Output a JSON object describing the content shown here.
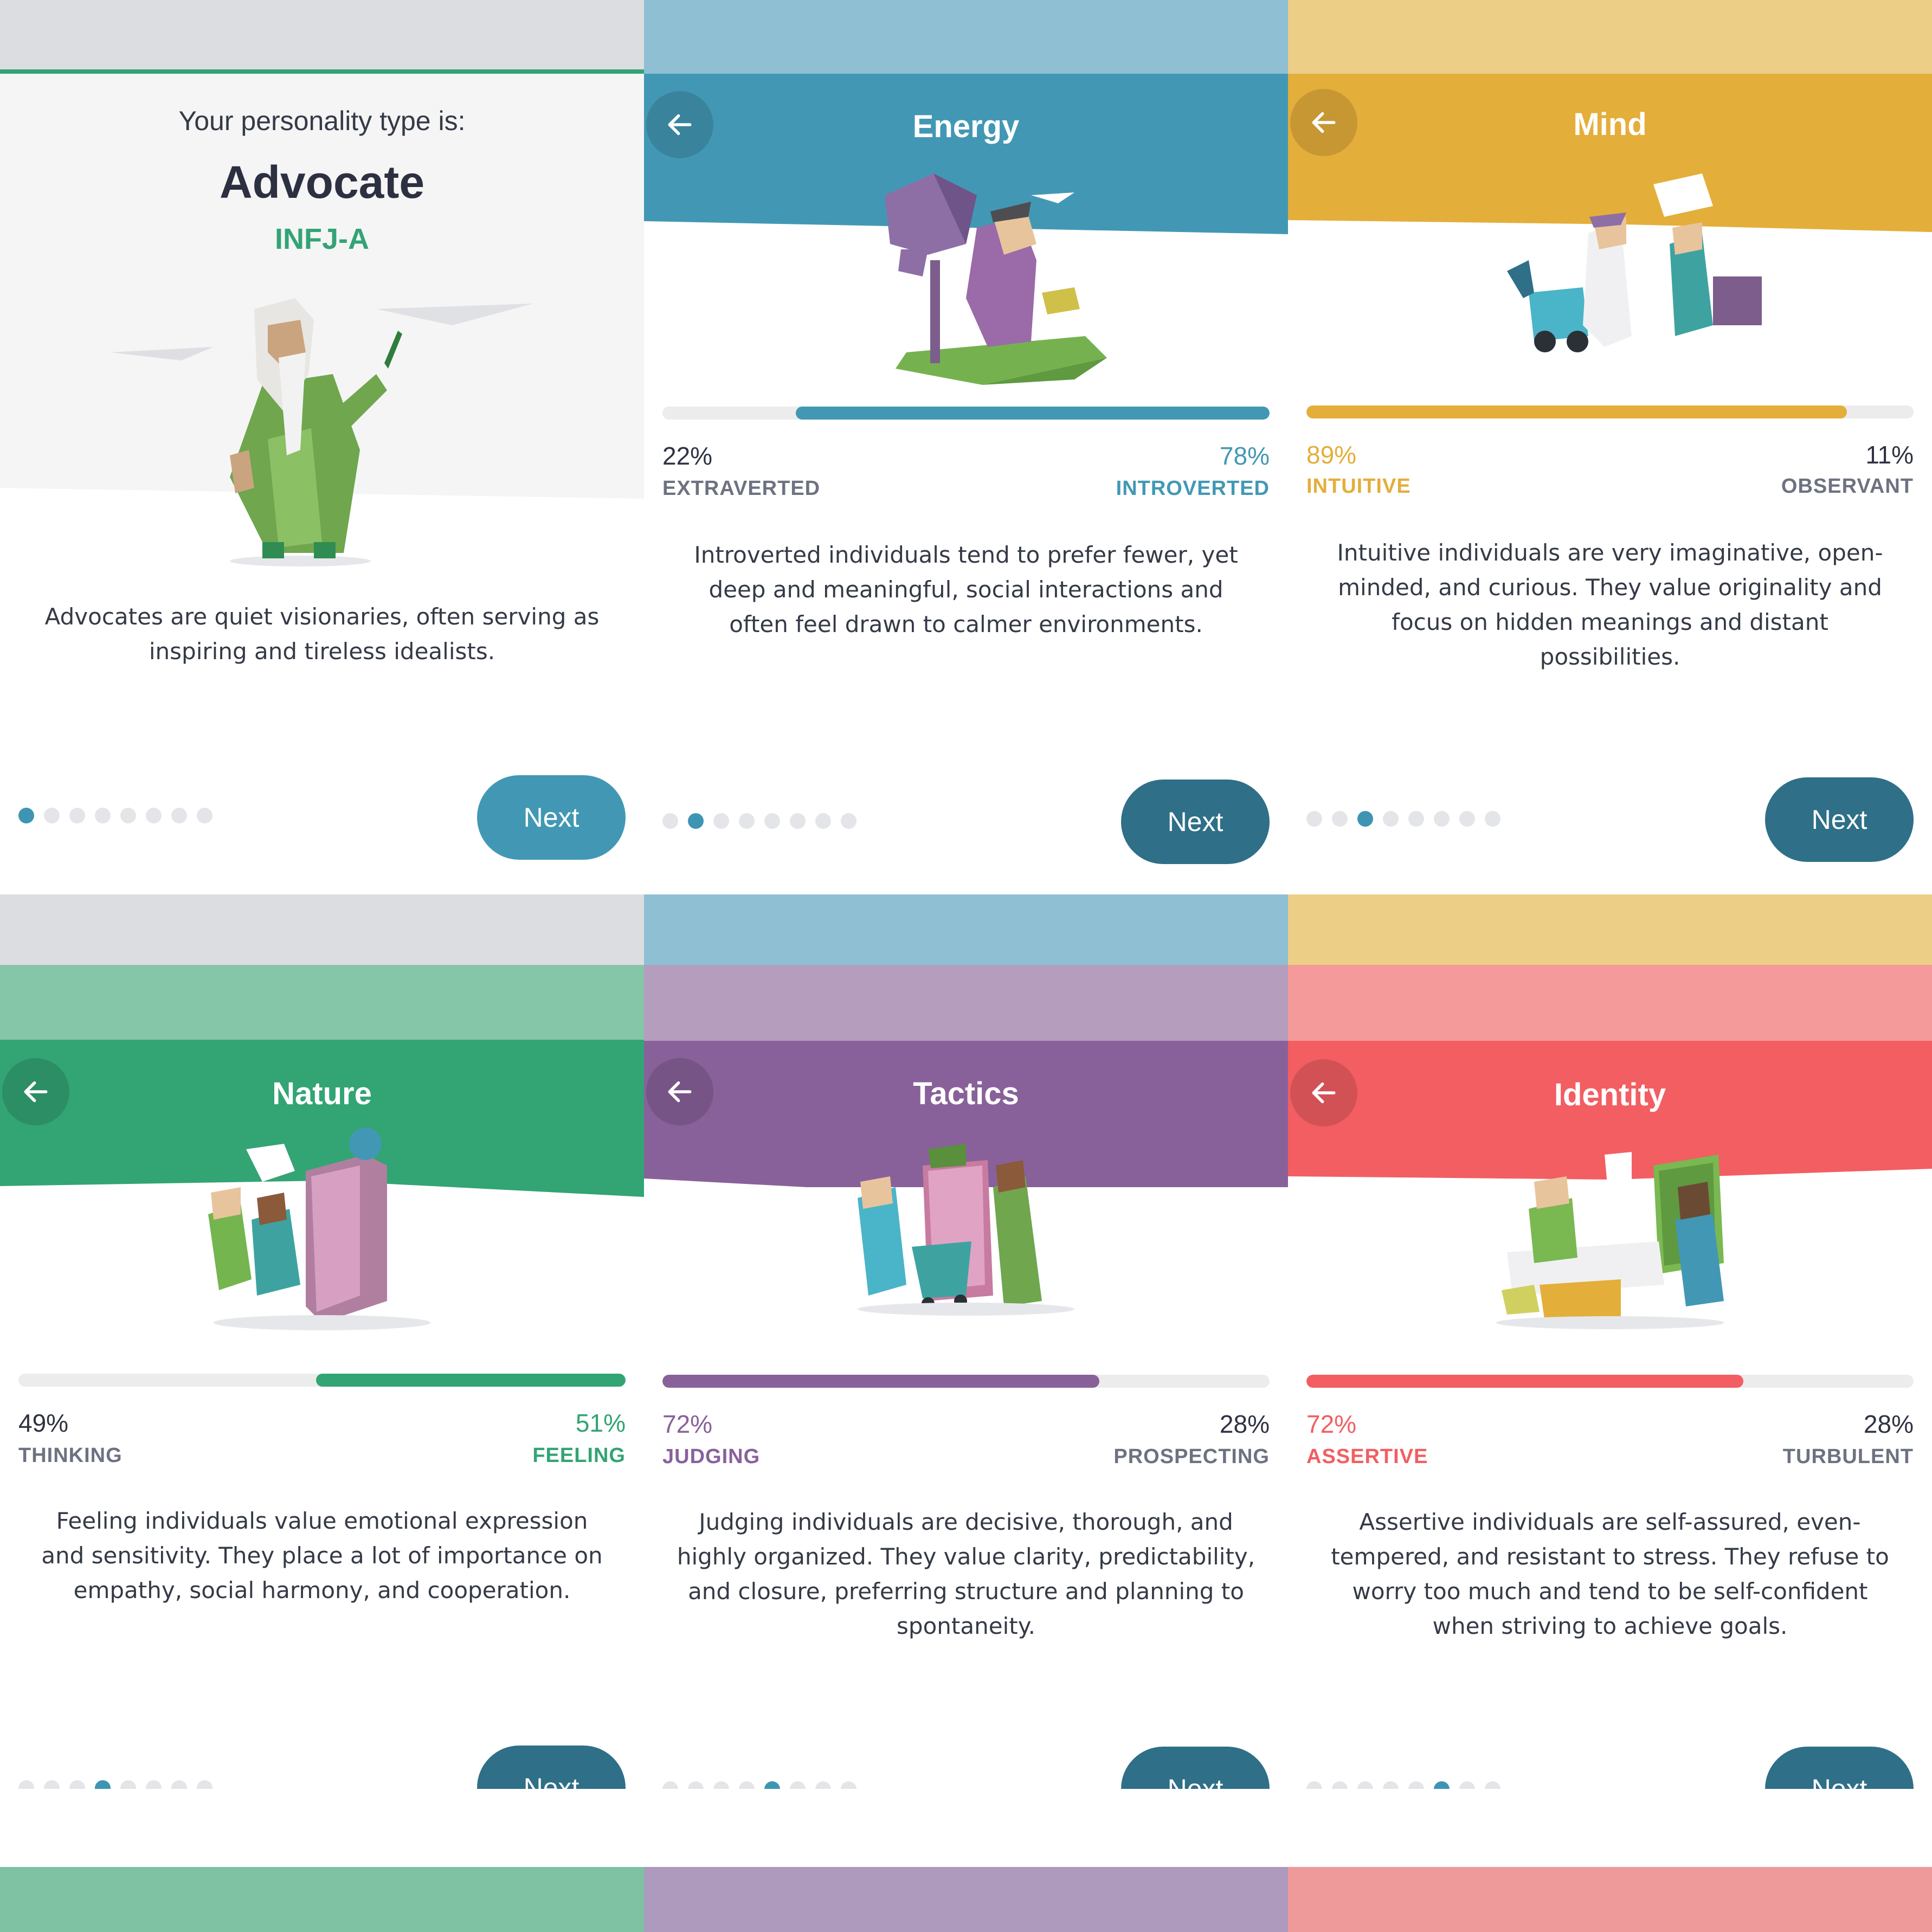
{
  "colors": {
    "advocate_green": "#33a474",
    "energy_blue": "#4298b4",
    "mind_yellow": "#e4ae3a",
    "nature_green": "#33a474",
    "tactics_purple": "#88619a",
    "identity_red": "#f25e62",
    "next_dark": "#2f6f88",
    "next_light": "#4298b4"
  },
  "intro": {
    "subtitle": "Your personality type is:",
    "type_name": "Advocate",
    "type_code": "INFJ-A",
    "description": "Advocates are quiet visionaries, often serving as inspiring and tireless idealists.",
    "next_label": "Next",
    "page_index": 0,
    "page_count": 8,
    "illustration_icon": "wizard-illustration-icon"
  },
  "energy": {
    "title": "Energy",
    "left_pct": "22%",
    "right_pct": "78%",
    "left_trait": "EXTRAVERTED",
    "right_trait": "INTROVERTED",
    "dominant": "right",
    "dominant_fraction": 0.78,
    "description": "Introverted individuals tend to prefer fewer, yet deep and meaningful, social interactions and often feel drawn to calmer environments.",
    "next_label": "Next",
    "page_index": 1,
    "page_count": 8,
    "illustration_icon": "tree-person-illustration-icon"
  },
  "mind": {
    "title": "Mind",
    "left_pct": "89%",
    "right_pct": "11%",
    "left_trait": "INTUITIVE",
    "right_trait": "OBSERVANT",
    "dominant": "left",
    "dominant_fraction": 0.89,
    "description": "Intuitive individuals are very imaginative, open-minded, and curious. They value originality and focus on hidden meanings and distant possibilities.",
    "next_label": "Next",
    "page_index": 2,
    "page_count": 8,
    "illustration_icon": "inventors-illustration-icon"
  },
  "nature": {
    "title": "Nature",
    "left_pct": "49%",
    "right_pct": "51%",
    "left_trait": "THINKING",
    "right_trait": "FEELING",
    "dominant": "right",
    "dominant_fraction": 0.51,
    "description": "Feeling individuals value emotional expression and sensitivity. They place a lot of importance on empathy, social harmony, and cooperation.",
    "next_label": "Next",
    "page_index": 3,
    "page_count": 8,
    "illustration_icon": "lockers-illustration-icon"
  },
  "tactics": {
    "title": "Tactics",
    "left_pct": "72%",
    "right_pct": "28%",
    "left_trait": "JUDGING",
    "right_trait": "PROSPECTING",
    "dominant": "left",
    "dominant_fraction": 0.72,
    "description": "Judging individuals are decisive, thorough, and highly organized. They value clarity, predictability, and closure, preferring structure and planning to spontaneity.",
    "next_label": "Next",
    "page_index": 4,
    "page_count": 8,
    "illustration_icon": "shopping-cart-illustration-icon"
  },
  "identity": {
    "title": "Identity",
    "left_pct": "72%",
    "right_pct": "28%",
    "left_trait": "ASSERTIVE",
    "right_trait": "TURBULENT",
    "dominant": "left",
    "dominant_fraction": 0.72,
    "description": "Assertive individuals are self-assured, even-tempered, and resistant to stress. They refuse to worry too much and tend to be self-confident when striving to achieve goals.",
    "next_label": "Next",
    "page_index": 5,
    "page_count": 8,
    "illustration_icon": "office-desk-illustration-icon"
  }
}
